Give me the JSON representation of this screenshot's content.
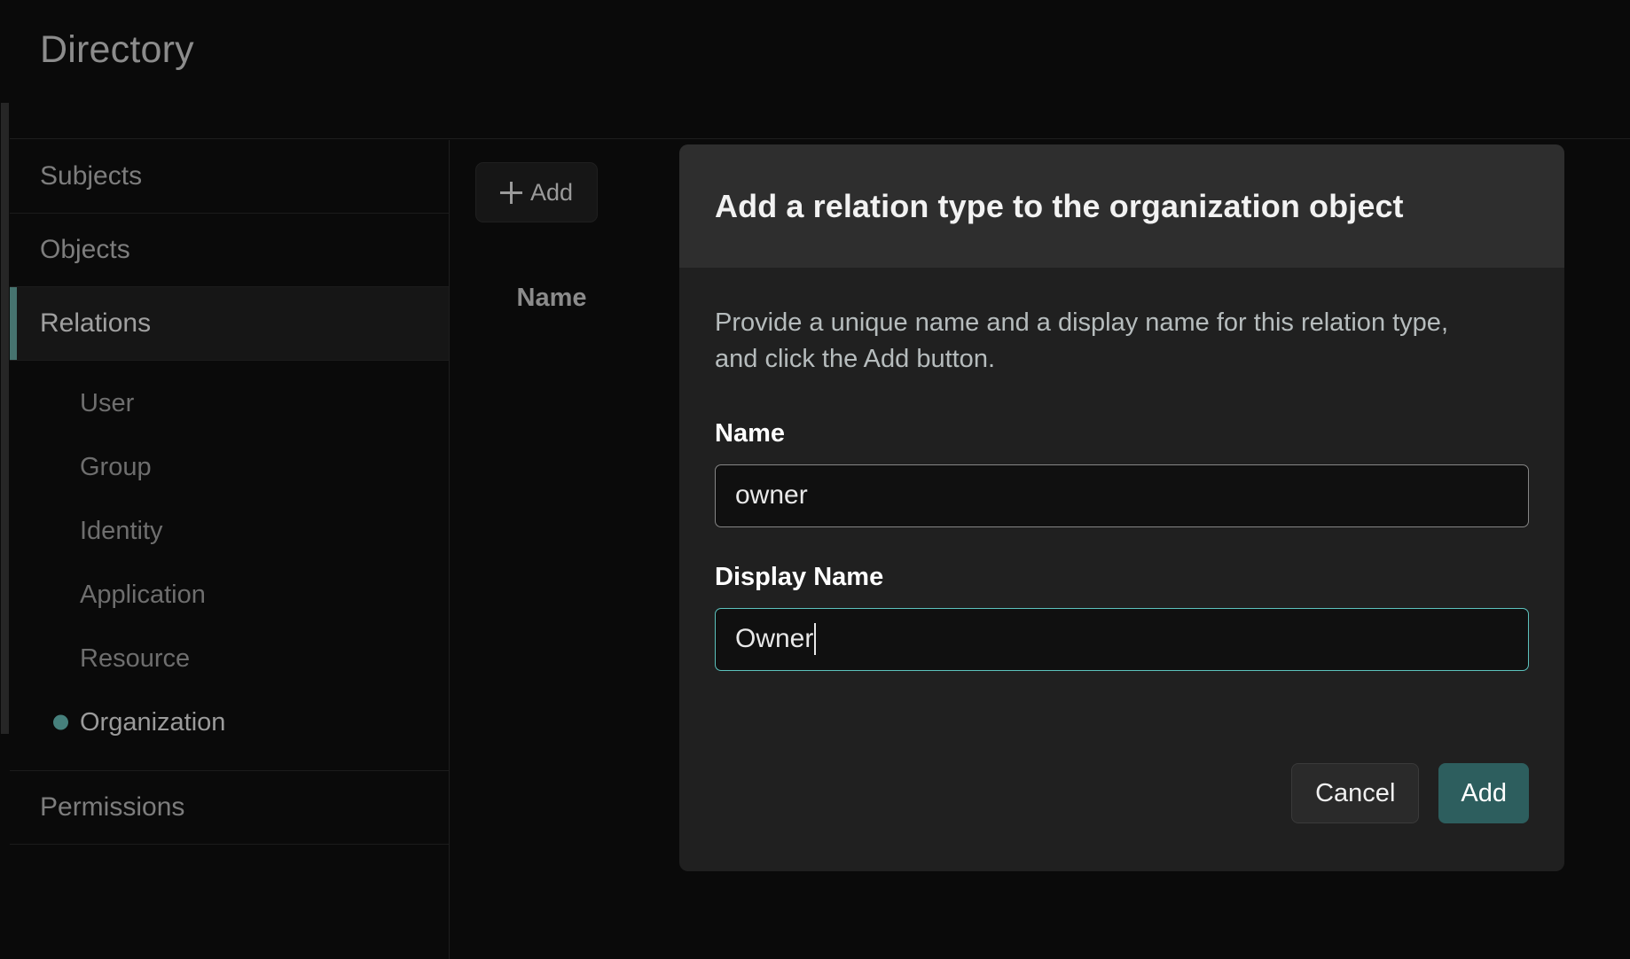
{
  "app": {
    "title": "Directory",
    "accent_color": "#46807c",
    "background_color": "#0a0a0a"
  },
  "sidebar": {
    "items": [
      {
        "label": "Subjects",
        "selected": false
      },
      {
        "label": "Objects",
        "selected": false
      },
      {
        "label": "Relations",
        "selected": true
      },
      {
        "label": "Permissions",
        "selected": false
      }
    ],
    "relations_children": [
      {
        "label": "User",
        "selected": false
      },
      {
        "label": "Group",
        "selected": false
      },
      {
        "label": "Identity",
        "selected": false
      },
      {
        "label": "Application",
        "selected": false
      },
      {
        "label": "Resource",
        "selected": false
      },
      {
        "label": "Organization",
        "selected": true
      }
    ]
  },
  "list_panel": {
    "add_button": {
      "label": "Add",
      "icon": "plus-icon"
    },
    "column_headers": [
      "Name"
    ],
    "rows": []
  },
  "modal": {
    "title": "Add a relation type to the organization object",
    "description": "Provide a unique name and a display name for this relation type, and click the Add button.",
    "fields": [
      {
        "label": "Name",
        "value": "owner",
        "placeholder": "",
        "focused": false
      },
      {
        "label": "Display Name",
        "value": "Owner",
        "placeholder": "",
        "focused": true
      }
    ],
    "cancel_label": "Cancel",
    "submit_label": "Add",
    "focus_border_color": "#5cc2bd",
    "submit_color": "#2d5e5e"
  }
}
